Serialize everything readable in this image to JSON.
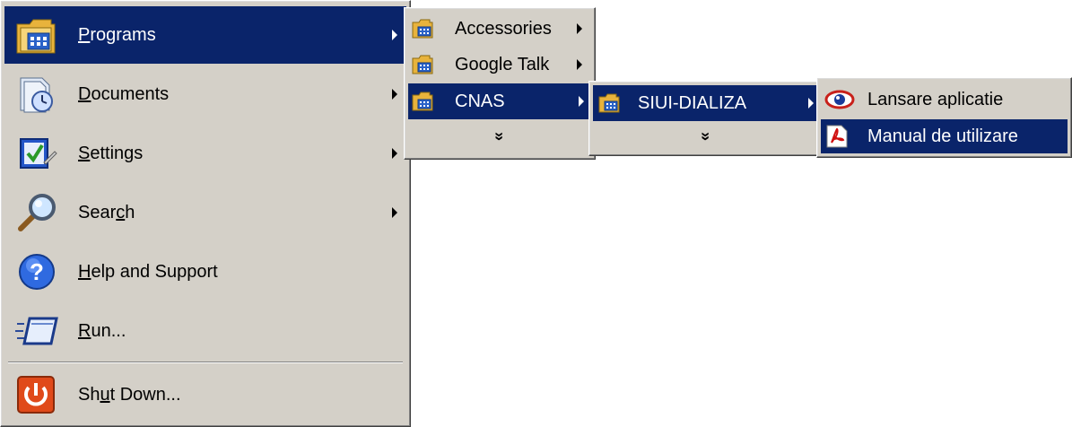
{
  "start_menu": {
    "items": [
      {
        "label": "Programs",
        "accel_prefix": "",
        "accel": "P",
        "accel_suffix": "rograms",
        "icon": "programs-folder-icon",
        "submenu": true,
        "selected": true
      },
      {
        "label": "Documents",
        "accel_prefix": "",
        "accel": "D",
        "accel_suffix": "ocuments",
        "icon": "documents-icon",
        "submenu": true,
        "selected": false
      },
      {
        "label": "Settings",
        "accel_prefix": "",
        "accel": "S",
        "accel_suffix": "ettings",
        "icon": "settings-icon",
        "submenu": true,
        "selected": false
      },
      {
        "label": "Search",
        "accel_prefix": "Sear",
        "accel": "c",
        "accel_suffix": "h",
        "icon": "search-icon",
        "submenu": true,
        "selected": false
      },
      {
        "label": "Help and Support",
        "accel_prefix": "",
        "accel": "H",
        "accel_suffix": "elp and Support",
        "icon": "help-icon",
        "submenu": false,
        "selected": false
      },
      {
        "label": "Run...",
        "accel_prefix": "",
        "accel": "R",
        "accel_suffix": "un...",
        "icon": "run-icon",
        "submenu": false,
        "selected": false
      }
    ],
    "shutdown": {
      "label": "Shut Down...",
      "accel_prefix": "Sh",
      "accel": "u",
      "accel_suffix": "t Down...",
      "icon": "shutdown-icon"
    }
  },
  "programs_menu": {
    "items": [
      {
        "label": "Accessories",
        "icon": "program-group-icon",
        "submenu": true,
        "selected": false
      },
      {
        "label": "Google Talk",
        "icon": "program-group-icon",
        "submenu": true,
        "selected": false
      },
      {
        "label": "CNAS",
        "icon": "program-group-icon",
        "submenu": true,
        "selected": true
      }
    ],
    "expand_glyph": "»"
  },
  "cnas_menu": {
    "items": [
      {
        "label": "SIUI-DIALIZA",
        "icon": "program-group-icon",
        "submenu": true,
        "selected": true
      }
    ],
    "expand_glyph": "»"
  },
  "siui_menu": {
    "items": [
      {
        "label": "Lansare aplicatie",
        "icon": "app-eye-icon",
        "selected": false
      },
      {
        "label": "Manual de utilizare",
        "icon": "pdf-icon",
        "selected": true
      }
    ]
  },
  "colors": {
    "menu_bg": "#d4d0c8",
    "highlight": "#0a246a",
    "highlight_text": "#ffffff"
  }
}
